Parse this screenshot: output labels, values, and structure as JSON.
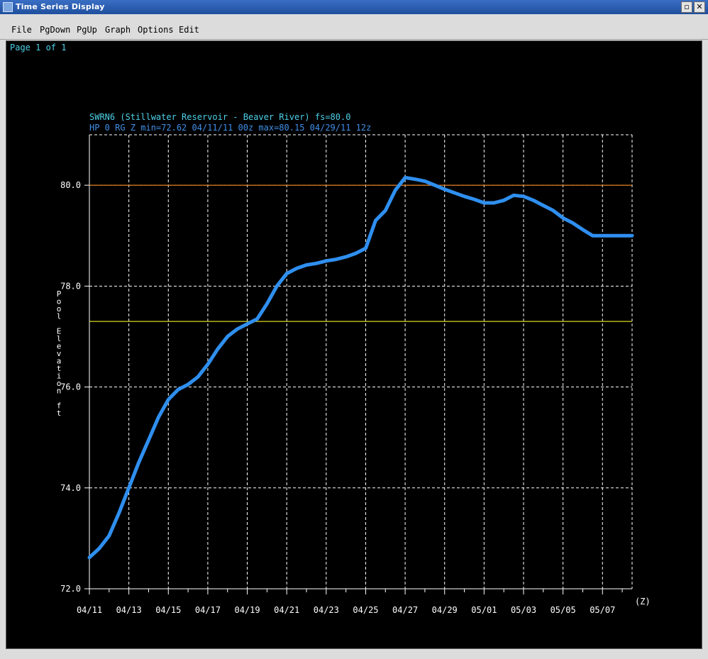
{
  "window": {
    "title": "Time Series Display"
  },
  "menu": {
    "items": [
      {
        "label": "File"
      },
      {
        "label": "PgDown"
      },
      {
        "label": "PgUp"
      },
      {
        "label": "Graph"
      },
      {
        "label": "Options"
      },
      {
        "label": "Edit"
      }
    ]
  },
  "page": {
    "label": "Page 1 of 1"
  },
  "colors": {
    "background": "#000000",
    "grid": "#ffffff",
    "series": "#2f8fef",
    "flood_stage_line": "#e07a20",
    "action_stage_line": "#d8d820",
    "title_text": "#4ed0e8",
    "subtitle_text": "#3f8fe8"
  },
  "chart_data": {
    "type": "line",
    "title": "SWRN6 (Stillwater Reservoir - Beaver River) fs=80.0",
    "subtitle": "HP 0 RG Z min=72.62 04/11/11 00z max=80.15 04/29/11 12z",
    "ylabel": "Pool Elevation ft",
    "xlabel": "(Z)",
    "ylim": [
      72.0,
      81.0
    ],
    "yticks": [
      "72.0",
      "74.0",
      "76.0",
      "78.0",
      "80.0"
    ],
    "yticks_values": [
      72,
      74,
      76,
      78,
      80
    ],
    "xlim": [
      "04/11 00z",
      "05/08 12z"
    ],
    "xtick_labels": [
      "04/11",
      "04/13",
      "04/15",
      "04/17",
      "04/19",
      "04/21",
      "04/23",
      "04/25",
      "04/27",
      "04/29",
      "05/01",
      "05/03",
      "05/05",
      "05/07"
    ],
    "x_unit": "day",
    "grid": true,
    "reference_lines": [
      {
        "value": 80.0,
        "color": "#e07a20"
      },
      {
        "value": 77.3,
        "color": "#d8d820"
      }
    ],
    "series": [
      {
        "x": [
          0,
          0.5,
          1.0,
          1.5,
          2.0,
          2.5,
          3.0,
          3.5,
          4.0,
          4.5,
          5.0,
          5.5,
          6.0,
          6.5,
          7.0,
          7.5,
          8.0,
          8.5,
          9.0,
          9.5,
          10.0,
          10.5,
          11.0,
          11.5,
          12.0,
          12.5,
          13.0,
          13.5,
          14.0,
          14.5,
          15.0,
          15.5,
          16.0,
          16.5,
          17.0,
          17.5,
          18.0,
          18.5,
          19.0,
          19.5,
          20.0,
          20.5,
          21.0,
          21.5,
          22.0,
          22.5,
          23.0,
          23.5,
          24.0,
          24.5,
          25.0,
          25.5,
          26.0,
          26.5,
          27.0,
          27.5
        ],
        "values": [
          72.62,
          72.8,
          73.05,
          73.5,
          74.0,
          74.5,
          74.95,
          75.4,
          75.75,
          75.95,
          76.05,
          76.2,
          76.45,
          76.75,
          77.0,
          77.15,
          77.25,
          77.35,
          77.65,
          78.0,
          78.25,
          78.35,
          78.42,
          78.45,
          78.5,
          78.53,
          78.58,
          78.65,
          78.75,
          79.3,
          79.5,
          79.9,
          80.15,
          80.12,
          80.08,
          80.0,
          79.92,
          79.85,
          79.78,
          79.72,
          79.65,
          79.65,
          79.7,
          79.8,
          79.78,
          79.7,
          79.6,
          79.5,
          79.35,
          79.25,
          79.12,
          79.0,
          79.0,
          79.0,
          79.0,
          79.0
        ]
      }
    ]
  }
}
